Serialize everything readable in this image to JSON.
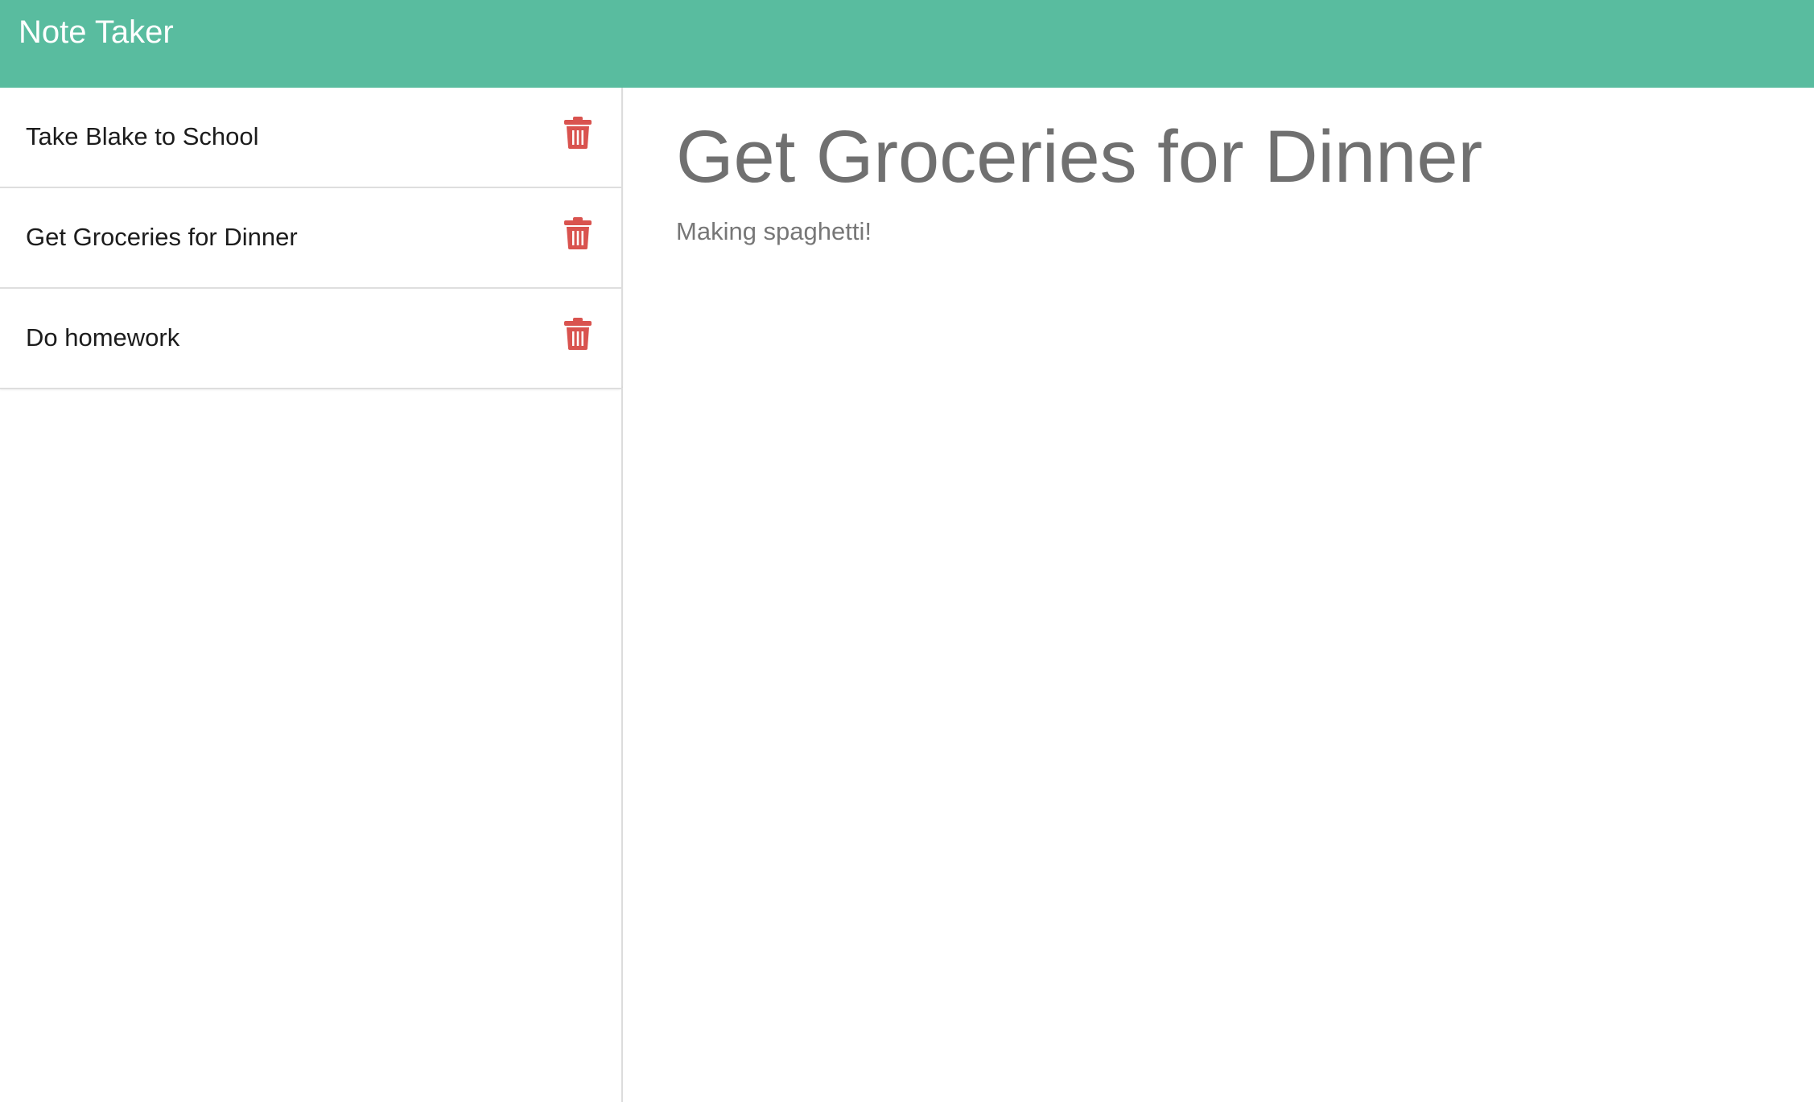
{
  "header": {
    "brand": "Note Taker",
    "background_color": "#59bc9f"
  },
  "sidebar": {
    "notes": [
      {
        "title": "Take Blake to School",
        "delete_icon": "trash-icon"
      },
      {
        "title": "Get Groceries for Dinner",
        "delete_icon": "trash-icon"
      },
      {
        "title": "Do homework",
        "delete_icon": "trash-icon"
      }
    ],
    "delete_icon_color": "#d9534f"
  },
  "main": {
    "note_title": "Get Groceries for Dinner",
    "note_text": "Making spaghetti!"
  }
}
